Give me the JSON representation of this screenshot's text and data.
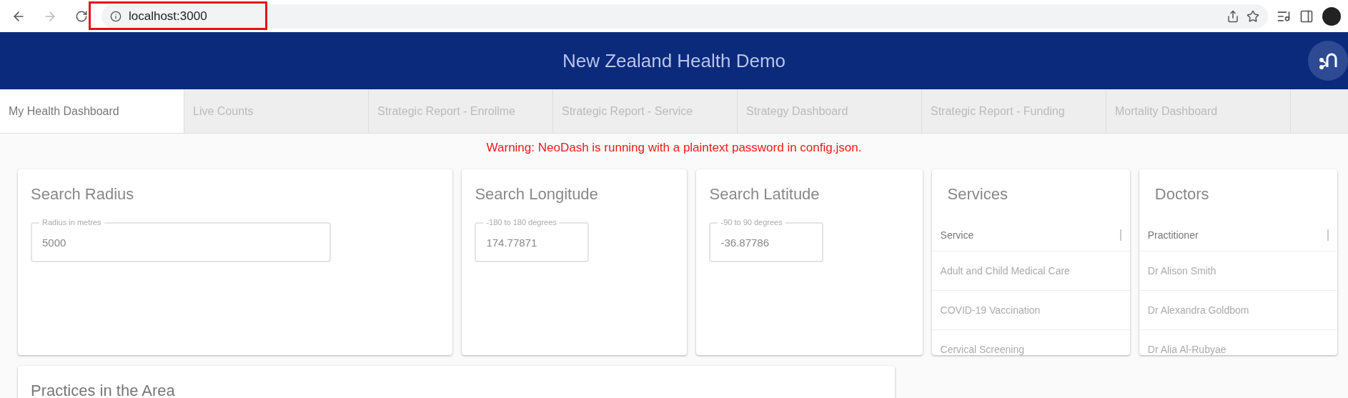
{
  "browser": {
    "address": "localhost:3000",
    "address_highlighted": true
  },
  "header": {
    "title": "New Zealand Health Demo"
  },
  "tabs": [
    {
      "label": "My Health Dashboard",
      "selected": true
    },
    {
      "label": "Live Counts",
      "selected": false
    },
    {
      "label": "Strategic Report - Enrollme",
      "selected": false
    },
    {
      "label": "Strategic Report - Service",
      "selected": false
    },
    {
      "label": "Strategy Dashboard",
      "selected": false
    },
    {
      "label": "Strategic Report - Funding",
      "selected": false
    },
    {
      "label": "Mortality Dashboard",
      "selected": false
    }
  ],
  "warning": "Warning: NeoDash is running with a plaintext password in config.json.",
  "cards": [
    {
      "kind": "field",
      "title": "Search Radius",
      "field_label": "Radius in metres",
      "value": "5000",
      "wide": true
    },
    {
      "kind": "field",
      "title": "Search Longitude",
      "field_label": "-180 to 180 degrees",
      "value": "174.77871",
      "wide": false
    },
    {
      "kind": "field",
      "title": "Search Latitude",
      "field_label": "-90 to 90 degrees",
      "value": "-36.87786",
      "wide": false
    },
    {
      "kind": "table",
      "title": "Services",
      "column": "Service",
      "rows": [
        "Adult and Child Medical Care",
        "COVID-19 Vaccination",
        "Cervical Screening"
      ]
    },
    {
      "kind": "table",
      "title": "Doctors",
      "column": "Practitioner",
      "rows": [
        "Dr Alison Smith",
        "Dr Alexandra Goldbom",
        "Dr Alia Al-Rubyae"
      ]
    }
  ],
  "bottom_card": {
    "title": "Practices in the Area"
  }
}
